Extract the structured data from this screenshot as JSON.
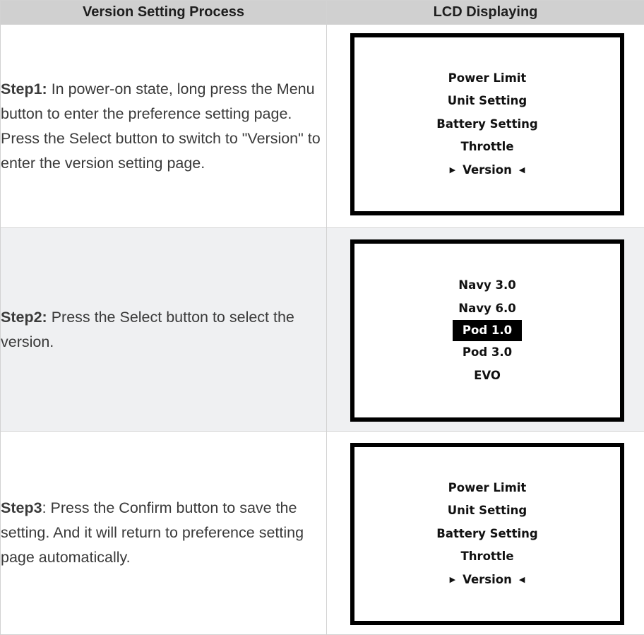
{
  "header": {
    "left": "Version Setting Process",
    "right": "LCD Displaying"
  },
  "rows": [
    {
      "step_label": "Step1:",
      "step_text": " In power-on state, long press the Menu button to enter the preference setting page. Press the Select button to switch to \"Version\" to enter the version setting page.",
      "lcd": {
        "items": [
          "Power Limit",
          "Unit Setting",
          "Battery Setting",
          "Throttle"
        ],
        "selected": "Version",
        "arrow_left": "▶",
        "arrow_right": "◀"
      }
    },
    {
      "step_label": "Step2:",
      "step_text": " Press the Select button to select the version.",
      "lcd": {
        "items": [
          "Navy 3.0",
          "Navy 6.0",
          "Pod 1.0",
          "Pod 3.0",
          "EVO"
        ],
        "highlighted": "Pod 1.0"
      }
    },
    {
      "step_label": "Step3",
      "step_text": ": Press the Confirm button to save the setting. And it will return to preference setting page automatically.",
      "lcd": {
        "items": [
          "Power Limit",
          "Unit Setting",
          "Battery Setting",
          "Throttle"
        ],
        "selected": "Version",
        "arrow_left": "▶",
        "arrow_right": "◀"
      }
    }
  ],
  "colors": {
    "header_bg": "#d0d0d0",
    "alt_row_bg": "#eff0f2",
    "border": "#d2d2d2",
    "lcd_frame": "#000000"
  }
}
